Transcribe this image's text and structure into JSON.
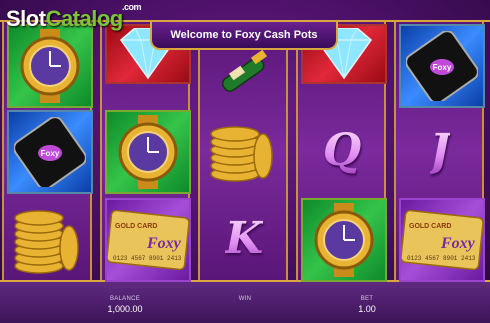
{
  "logo": {
    "brand_part1": "Slot",
    "brand_part2": "Catalog",
    "domain": ".com"
  },
  "banner": {
    "text": "Welcome to Foxy Cash Pots"
  },
  "card_text": {
    "title": "GOLD CARD",
    "brand": "Foxy",
    "number": "0123 4567 8901 2413"
  },
  "phone_text": "Foxy",
  "symbols": {
    "q": "Q",
    "k": "K",
    "j": "J"
  },
  "footer": {
    "balance_label": "BALANCE",
    "balance_value": "1,000.00",
    "win_label": "WIN",
    "win_value": "",
    "bet_label": "BET",
    "bet_value": "1.00"
  },
  "colors": {
    "frame_gold": "#d9a640",
    "reel_purple": "#6a1e8a",
    "logo_green": "#7cc43a"
  }
}
